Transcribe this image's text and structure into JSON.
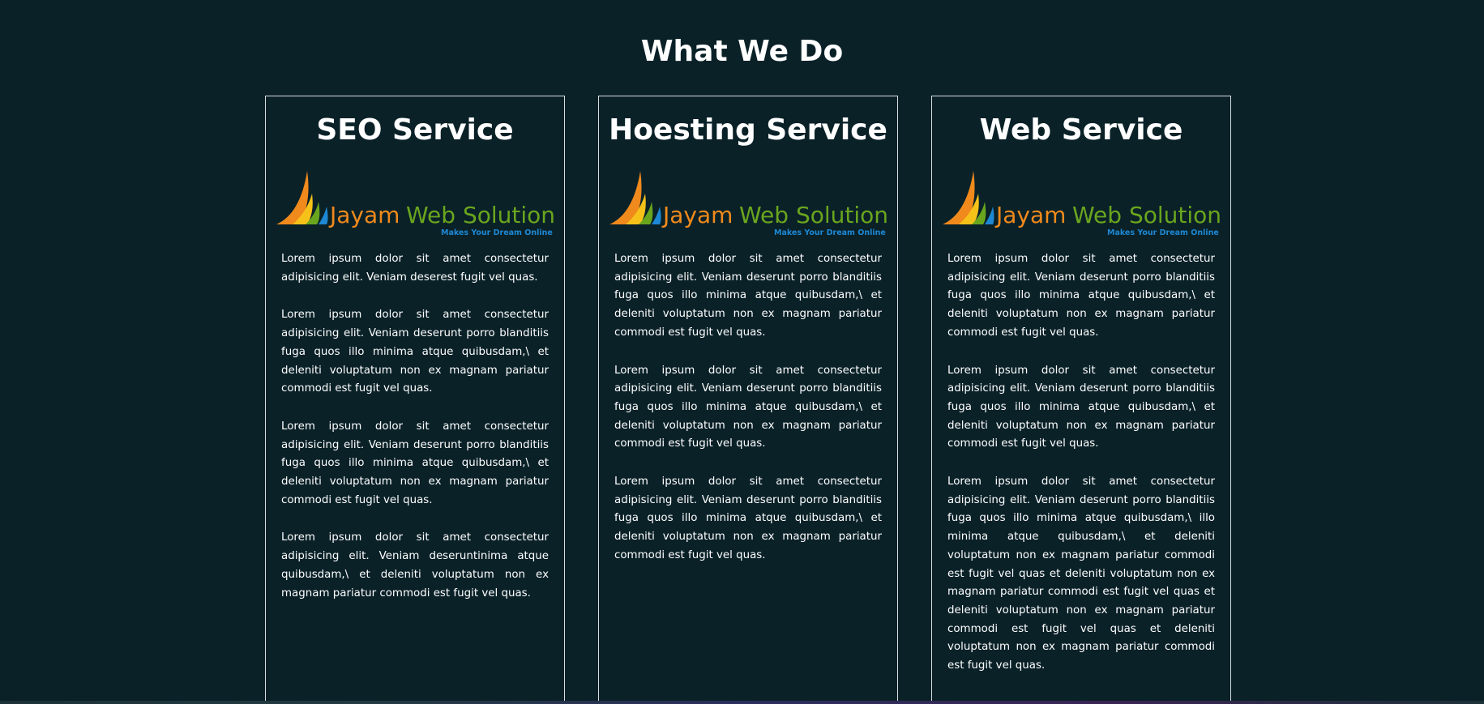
{
  "section": {
    "title": "What We Do"
  },
  "logo": {
    "brand_name": "Jayam Web Solutions",
    "tagline": "Makes Your Dream Online",
    "colors": {
      "orange": "#f08a1c",
      "green": "#6aa51e",
      "blue": "#1e88d4",
      "yellow": "#f6c21a"
    }
  },
  "cards": [
    {
      "title": "SEO Service",
      "paragraphs": [
        "Lorem ipsum dolor sit amet consectetur adipisicing elit. Veniam deserest fugit vel quas.",
        "Lorem ipsum dolor sit amet consectetur adipisicing elit. Veniam deserunt porro blanditiis fuga quos illo minima atque quibusdam,\\ et deleniti voluptatum non ex magnam pariatur commodi est fugit vel quas.",
        "Lorem ipsum dolor sit amet consectetur adipisicing elit. Veniam deserunt porro blanditiis fuga quos illo minima atque quibusdam,\\ et deleniti voluptatum non ex magnam pariatur commodi est fugit vel quas.",
        "Lorem ipsum dolor sit amet consectetur adipisicing elit. Veniam deseruntinima atque quibusdam,\\ et deleniti voluptatum non ex magnam pariatur commodi est fugit vel quas."
      ]
    },
    {
      "title": "Hoesting Service",
      "paragraphs": [
        "Lorem ipsum dolor sit amet consectetur adipisicing elit. Veniam deserunt porro blanditiis fuga quos illo minima atque quibusdam,\\ et deleniti voluptatum non ex magnam pariatur commodi est fugit vel quas.",
        "Lorem ipsum dolor sit amet consectetur adipisicing elit. Veniam deserunt porro blanditiis fuga quos illo minima atque quibusdam,\\ et deleniti voluptatum non ex magnam pariatur commodi est fugit vel quas.",
        "Lorem ipsum dolor sit amet consectetur adipisicing elit. Veniam deserunt porro blanditiis fuga quos illo minima atque quibusdam,\\ et deleniti voluptatum non ex magnam pariatur commodi est fugit vel quas."
      ]
    },
    {
      "title": "Web Service",
      "paragraphs": [
        "Lorem ipsum dolor sit amet consectetur adipisicing elit. Veniam deserunt porro blanditiis fuga quos illo minima atque quibusdam,\\ et deleniti voluptatum non ex magnam pariatur commodi est fugit vel quas.",
        "Lorem ipsum dolor sit amet consectetur adipisicing elit. Veniam deserunt porro blanditiis fuga quos illo minima atque quibusdam,\\ et deleniti voluptatum non ex magnam pariatur commodi est fugit vel quas.",
        "Lorem ipsum dolor sit amet consectetur adipisicing elit. Veniam deserunt porro blanditiis fuga quos illo minima atque quibusdam,\\ illo minima atque quibusdam,\\ et deleniti voluptatum non ex magnam pariatur commodi est fugit vel quas et deleniti voluptatum non ex magnam pariatur commodi est fugit vel quas et deleniti voluptatum non ex magnam pariatur commodi est fugit vel quas et deleniti voluptatum non ex magnam pariatur commodi est fugit vel quas."
      ]
    }
  ]
}
